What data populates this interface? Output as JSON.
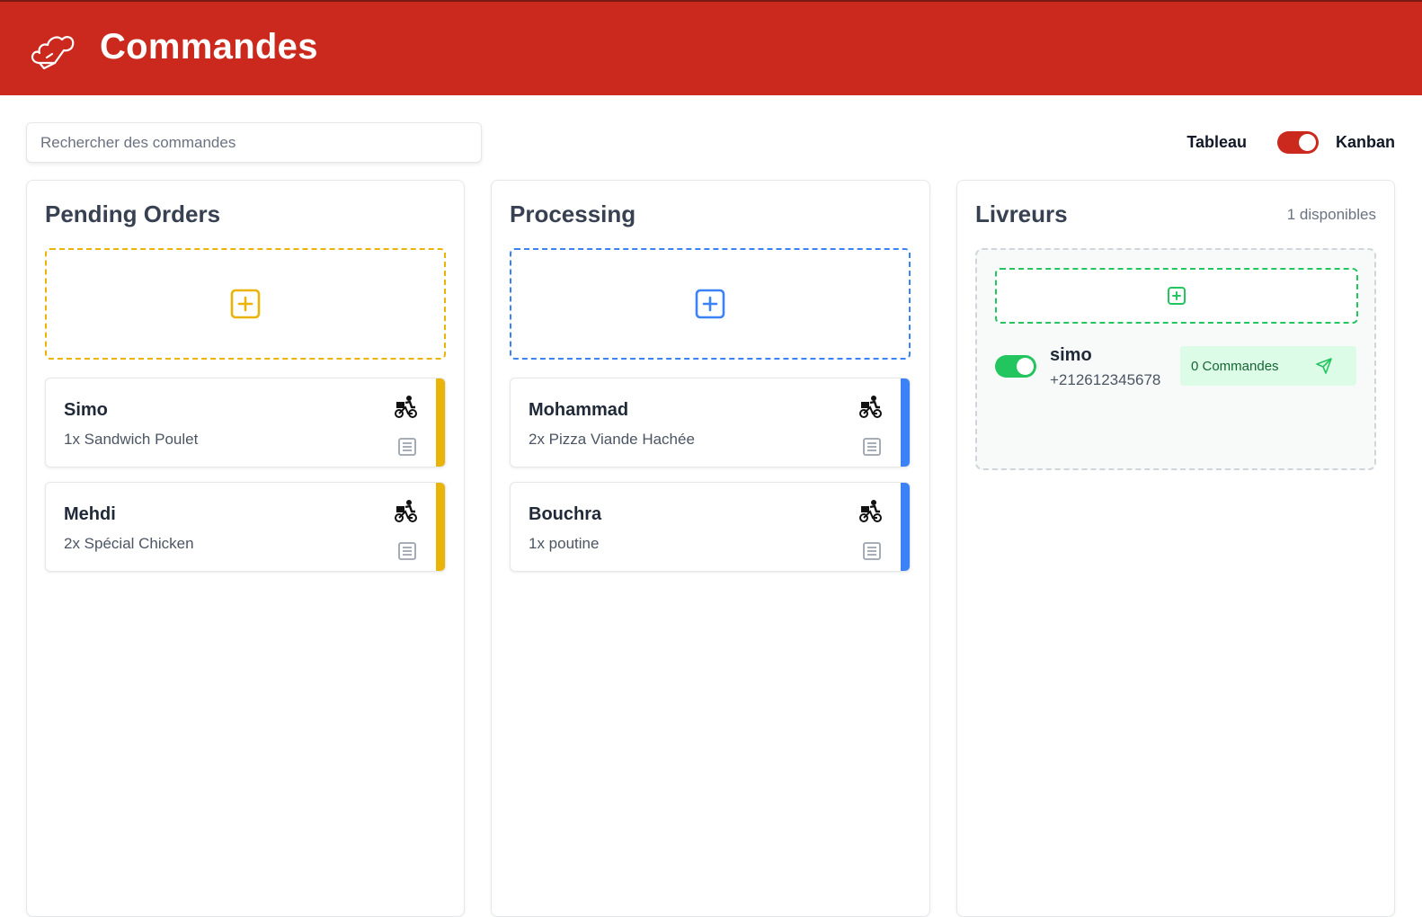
{
  "header": {
    "title": "Commandes",
    "logo_icon": "chef-hat-icon"
  },
  "search": {
    "placeholder": "Rechercher des commandes",
    "value": ""
  },
  "view_toggle": {
    "left_label": "Tableau",
    "right_label": "Kanban",
    "active": "Kanban"
  },
  "colors": {
    "header": "#cb291d",
    "pending": "#eab308",
    "processing": "#3b82f6",
    "available": "#22c55e"
  },
  "columns": [
    {
      "title": "Pending Orders",
      "orders": [
        {
          "name": "Simo",
          "items": "1x Sandwich Poulet"
        },
        {
          "name": "Mehdi",
          "items": "2x Spécial Chicken"
        }
      ]
    },
    {
      "title": "Processing",
      "orders": [
        {
          "name": "Mohammad",
          "items": "2x Pizza Viande Hachée"
        },
        {
          "name": "Bouchra",
          "items": "1x poutine"
        }
      ]
    }
  ],
  "drivers": {
    "title": "Livreurs",
    "count_label": "1 disponibles",
    "list": [
      {
        "name": "simo",
        "phone": "+212612345678",
        "orders_label": "0 Commandes",
        "available": true
      }
    ]
  },
  "icons": {
    "card_delivery": "bicycle-delivery-icon",
    "card_details": "note-icon",
    "add": "plus-square-icon",
    "send": "send-icon"
  }
}
